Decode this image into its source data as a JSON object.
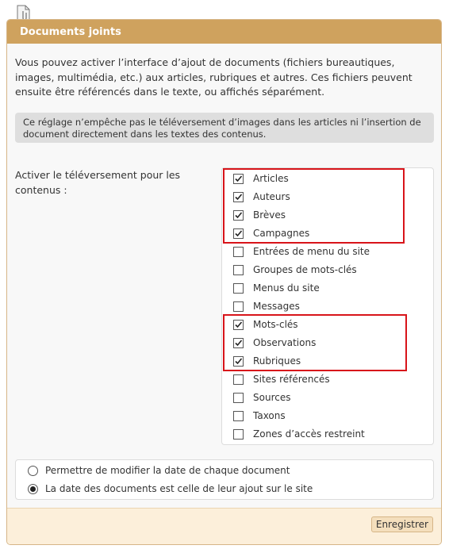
{
  "panel": {
    "title": "Documents joints"
  },
  "intro": "Vous pouvez activer l’interface d’ajout de documents (fichiers bureautiques, images, multimédia, etc.) aux articles, rubriques et autres. Ces fichiers peuvent ensuite être référencés dans le texte, ou affichés séparément.",
  "notice": "Ce réglage n’empêche pas le téléversement d’images dans les articles ni l’insertion de document directement dans les textes des contenus.",
  "field_label": "Activer le téléversement pour les contenus :",
  "checkboxes": [
    {
      "label": "Articles",
      "checked": true
    },
    {
      "label": "Auteurs",
      "checked": true
    },
    {
      "label": "Brèves",
      "checked": true
    },
    {
      "label": "Campagnes",
      "checked": true
    },
    {
      "label": "Entrées de menu du site",
      "checked": false
    },
    {
      "label": "Groupes de mots-clés",
      "checked": false
    },
    {
      "label": "Menus du site",
      "checked": false
    },
    {
      "label": "Messages",
      "checked": false
    },
    {
      "label": "Mots-clés",
      "checked": true
    },
    {
      "label": "Observations",
      "checked": true
    },
    {
      "label": "Rubriques",
      "checked": true
    },
    {
      "label": "Sites référencés",
      "checked": false
    },
    {
      "label": "Sources",
      "checked": false
    },
    {
      "label": "Taxons",
      "checked": false
    },
    {
      "label": "Zones d’accès restreint",
      "checked": false
    }
  ],
  "radios": [
    {
      "label": "Permettre de modifier la date de chaque document",
      "selected": false
    },
    {
      "label": "La date des documents est celle de leur ajout sur le site",
      "selected": true
    }
  ],
  "footer": {
    "save_label": "Enregistrer"
  },
  "colors": {
    "header": "#cfa25e",
    "highlight": "#d8141a",
    "footer": "#fcefda"
  }
}
